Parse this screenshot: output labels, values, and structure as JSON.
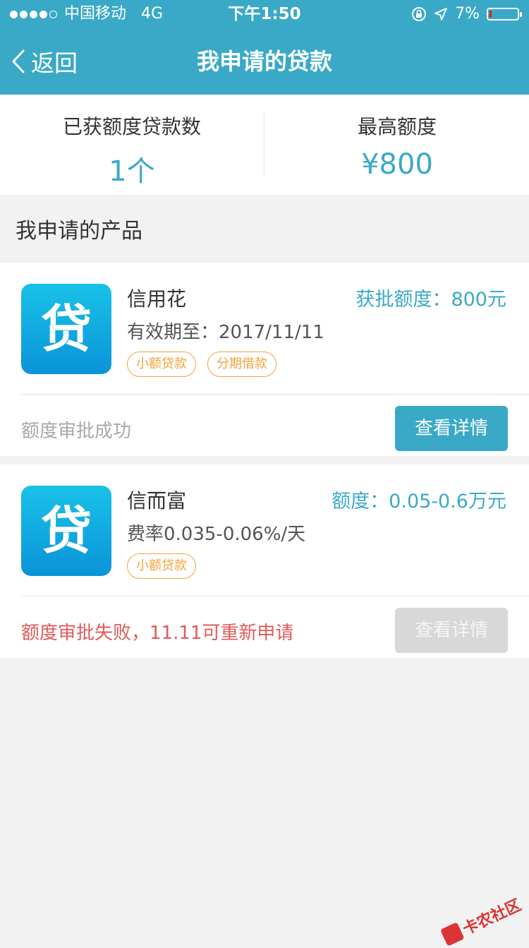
{
  "status_bar": {
    "carrier": "中国移动",
    "network": "4G",
    "time": "下午1:50",
    "battery_percent": "7%",
    "battery_level": 0.07
  },
  "navbar": {
    "back_label": "返回",
    "title": "我申请的贷款"
  },
  "summary": {
    "approved_label": "已获额度贷款数",
    "approved_value": "1个",
    "max_label": "最高额度",
    "max_value": "¥800"
  },
  "section_title": "我申请的产品",
  "loans": [
    {
      "logo": "贷",
      "name": "信用花",
      "amount": "获批额度：800元",
      "sub": "有效期至：2017/11/11",
      "tags": [
        "小额贷款",
        "分期借款"
      ],
      "status": "额度审批成功",
      "status_color": "#a8a8a8",
      "button": "查看详情",
      "button_enabled": true
    },
    {
      "logo": "贷",
      "name": "信而富",
      "amount": "额度：0.05-0.6万元",
      "sub": "费率0.035-0.06%/天",
      "tags": [
        "小额贷款"
      ],
      "status": "额度审批失败，11.11可重新申请",
      "status_color": "#e05a5a",
      "button": "查看详情",
      "button_enabled": false
    }
  ],
  "watermark": "卡农社区",
  "colors": {
    "accent": "#3aa9c7",
    "tag_orange": "#f0a43c",
    "error_red": "#e05a5a"
  }
}
